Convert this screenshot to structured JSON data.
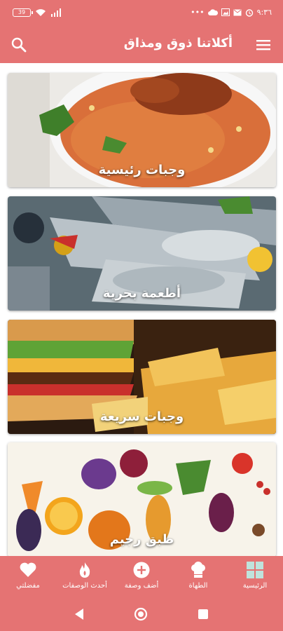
{
  "status_bar": {
    "battery": "39",
    "time": "٩:٣٦",
    "dots": "•••"
  },
  "app_bar": {
    "title": "أكلاتنا ذوق ومذاق"
  },
  "categories": [
    {
      "label": "وجبات رئيسية"
    },
    {
      "label": "أطعمة بحرية"
    },
    {
      "label": "وجبات سريعة"
    },
    {
      "label": "طبق رجيم"
    }
  ],
  "bottom_nav": {
    "items": [
      {
        "label": "مفضلتي",
        "icon": "heart-icon"
      },
      {
        "label": "أحدث الوصفات",
        "icon": "flame-icon"
      },
      {
        "label": "أضف وصفة",
        "icon": "add-circle-icon"
      },
      {
        "label": "الطهاة",
        "icon": "chef-hat-icon"
      },
      {
        "label": "الرئيسية",
        "icon": "grid-icon"
      }
    ]
  },
  "colors": {
    "primary": "#e57373",
    "white": "#ffffff"
  }
}
